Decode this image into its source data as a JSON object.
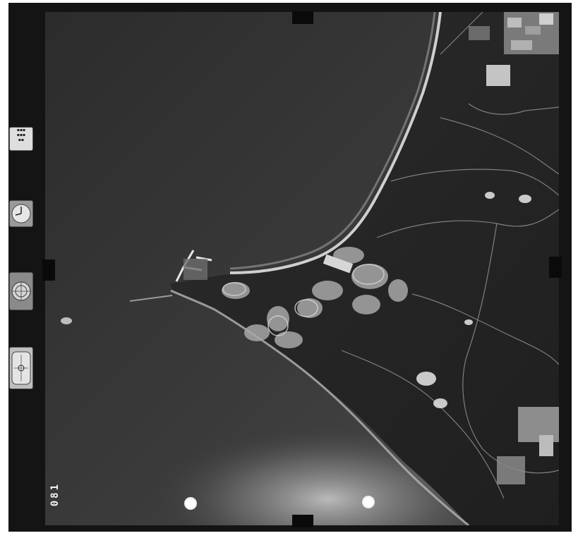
{
  "photo": {
    "kind": "aerial photograph",
    "frame_number": "081"
  },
  "side_instruments": [
    {
      "id": "data-card",
      "label": ""
    },
    {
      "id": "clock",
      "label": ""
    },
    {
      "id": "altimeter",
      "label": ""
    },
    {
      "id": "level-bubble",
      "label": ""
    }
  ],
  "colors": {
    "film_border": "#141414",
    "sea": "#3a3a3a",
    "land": "#262626",
    "beach": "#cfcfcf",
    "surf": "#9a9a9a"
  }
}
